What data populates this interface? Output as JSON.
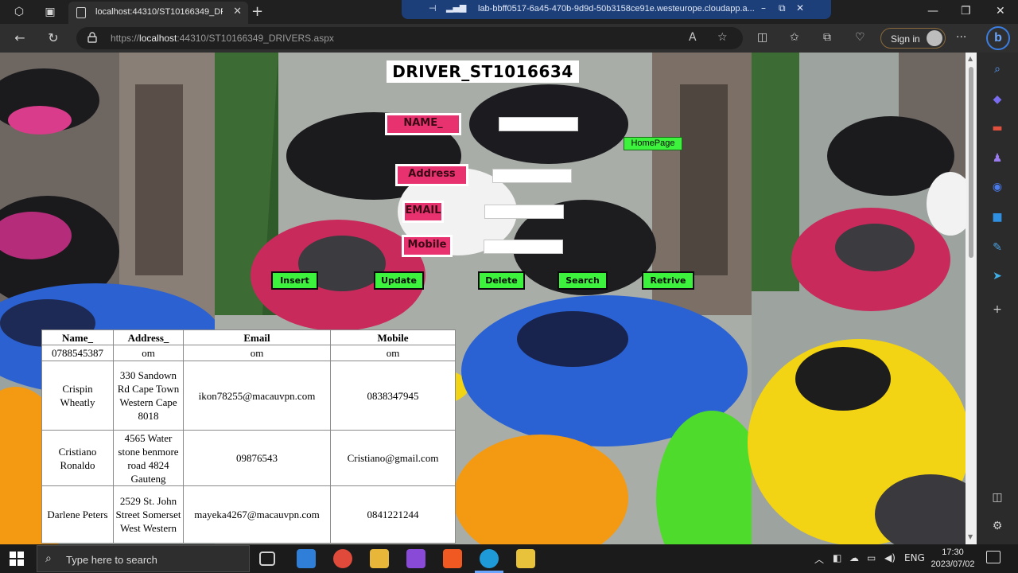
{
  "browser": {
    "tab_title": "localhost:44310/ST10166349_DR",
    "tab_close": "✕",
    "new_tab": "+",
    "url_host": "localhost",
    "url_prefix": "https://",
    "url_rest": ":44310/ST10166349_DRIVERS.aspx",
    "read_aloud": "A",
    "signin_label": "Sign in",
    "more": "···",
    "copilot": "b"
  },
  "remote_session": {
    "host": "lab-bbff0517-6a45-470b-9d9d-50b3158ce91e.westeurope.cloudapp.a..."
  },
  "page": {
    "title": "DRIVER_ST1016634",
    "labels": {
      "name": "NAME_",
      "address": "Address",
      "email": "EMAIL",
      "mobile": "Mobile"
    },
    "fields": {
      "name": "",
      "address": "",
      "email": "",
      "mobile": ""
    },
    "homepage_link": "HomePage",
    "buttons": {
      "insert": "Insert",
      "update": "Update",
      "delete": "Delete",
      "search": "Search",
      "retrieve": "Retrive"
    },
    "table": {
      "headers": [
        "Name_",
        "Address_",
        "Email",
        "Mobile"
      ],
      "rows": [
        [
          "0788545387",
          "om",
          "om",
          "om"
        ],
        [
          "Crispin Wheatly",
          "330 Sandown Rd Cape Town Western Cape 8018",
          "ikon78255@macauvpn.com",
          "0838347945"
        ],
        [
          "Cristiano Ronaldo",
          "4565 Water stone benmore road 4824 Gauteng",
          "09876543",
          "Cristiano@gmail.com"
        ],
        [
          "Darlene Peters",
          "2529 St. John Street Somerset West Western",
          "mayeka4267@macauvpn.com",
          "0841221244"
        ]
      ]
    }
  },
  "taskbar": {
    "search_placeholder": "Type here to search",
    "language": "ENG",
    "time": "17:30",
    "date": "2023/07/02"
  },
  "colors": {
    "label_bg": "#e8316f",
    "button_bg": "#3df23d",
    "edge_accent": "#3b7de0"
  }
}
